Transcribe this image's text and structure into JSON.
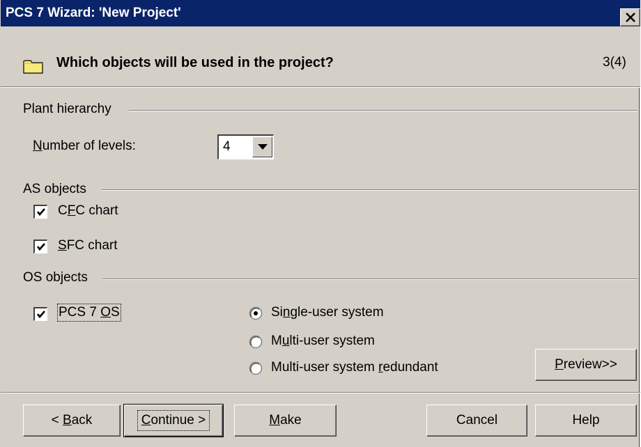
{
  "window": {
    "title": "PCS 7 Wizard: 'New Project'",
    "close_icon": "close-icon"
  },
  "header": {
    "question": "Which objects will be used in the project?",
    "step": "3(4)",
    "icon": "folder-icon"
  },
  "plant_hierarchy": {
    "group_label": "Plant hierarchy",
    "levels_label_prefix": "",
    "levels_label_underlined": "N",
    "levels_label_rest": "umber of levels:",
    "levels_value": "4"
  },
  "as_objects": {
    "group_label": "AS objects",
    "cfc": {
      "pre": "C",
      "u": "F",
      "post": "C chart",
      "checked": true
    },
    "sfc": {
      "pre": "",
      "u": "S",
      "post": "FC chart",
      "checked": true
    }
  },
  "os_objects": {
    "group_label": "OS objects",
    "pcs7os": {
      "pre": "PCS 7 ",
      "u": "O",
      "post": "S",
      "checked": true
    },
    "radios": [
      {
        "pre": "Si",
        "u": "n",
        "post": "gle-user system",
        "selected": true
      },
      {
        "pre": "M",
        "u": "u",
        "post": "lti-user system",
        "selected": false
      },
      {
        "pre": "Multi-user system ",
        "u": "r",
        "post": "edundant",
        "selected": false
      }
    ],
    "preview": {
      "u": "P",
      "post": "review>>"
    }
  },
  "buttons": {
    "back": {
      "pre": "< ",
      "u": "B",
      "post": "ack"
    },
    "continue": {
      "pre": "",
      "u": "C",
      "post": "ontinue >"
    },
    "make": {
      "pre": "",
      "u": "M",
      "post": "ake"
    },
    "cancel": "Cancel",
    "help": "Help"
  },
  "colors": {
    "titlebar": "#0a246a",
    "face": "#d4d0c8"
  }
}
